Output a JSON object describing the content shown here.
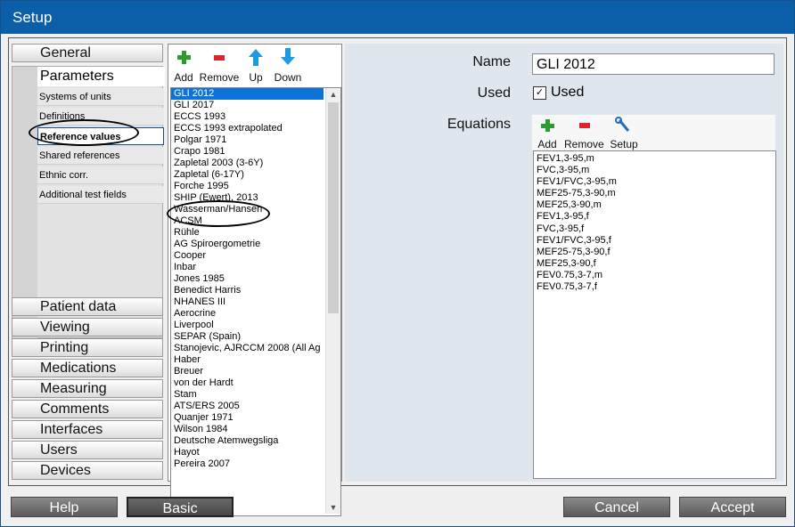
{
  "window": {
    "title": "Setup"
  },
  "nav": {
    "general": "General",
    "parameters": "Parameters",
    "sub_items": [
      "Systems of units",
      "Definitions",
      "Reference values",
      "Shared references",
      "Ethnic corr.",
      "Additional test fields"
    ],
    "bottom_items": [
      "Patient data",
      "Viewing",
      "Printing",
      "Medications",
      "Measuring",
      "Comments",
      "Interfaces",
      "Users",
      "Devices"
    ]
  },
  "reference_toolbar": {
    "add": "Add",
    "remove": "Remove",
    "up": "Up",
    "down": "Down"
  },
  "reference_list": [
    "GLI 2012",
    "GLI 2017",
    "ECCS 1993",
    "ECCS 1993 extrapolated",
    "Polgar 1971",
    "Crapo 1981",
    "Zapletal 2003 (3-6Y)",
    "Zapletal (6-17Y)",
    "Forche 1995",
    "SHIP (Ewert), 2013",
    "Wasserman/Hansen",
    "ACSM",
    "Rühle",
    "AG Spiroergometrie",
    "Cooper",
    "Inbar",
    "Jones 1985",
    "Benedict Harris",
    "NHANES III",
    "Aerocrine",
    "Liverpool",
    "SEPAR (Spain)",
    "Stanojevic, AJRCCM 2008 (All Ag",
    "Haber",
    "Breuer",
    "von der Hardt",
    "Stam",
    "ATS/ERS 2005",
    "Quanjer 1971",
    "Wilson 1984",
    "Deutsche Atemwegsliga",
    "Hayot",
    "Pereira 2007"
  ],
  "detail": {
    "name_label": "Name",
    "name_value": "GLI 2012",
    "used_label": "Used",
    "used_checkbox_label": "Used",
    "used_checked": true,
    "equations_label": "Equations",
    "eq_toolbar": {
      "add": "Add",
      "remove": "Remove",
      "setup": "Setup"
    },
    "equations": [
      "FEV1,3-95,m",
      "FVC,3-95,m",
      "FEV1/FVC,3-95,m",
      "MEF25-75,3-90,m",
      "MEF25,3-90,m",
      "FEV1,3-95,f",
      "FVC,3-95,f",
      "FEV1/FVC,3-95,f",
      "MEF25-75,3-90,f",
      "MEF25,3-90,f",
      "FEV0.75,3-7,m",
      "FEV0.75,3-7,f"
    ]
  },
  "buttons": {
    "help": "Help",
    "basic": "Basic",
    "cancel": "Cancel",
    "accept": "Accept"
  },
  "colors": {
    "titlebar": "#0b5ea8",
    "selection": "#0b74d6",
    "add_icon": "#2e9b2e",
    "remove_icon": "#d9262e",
    "arrow_icon": "#1e9be0"
  }
}
